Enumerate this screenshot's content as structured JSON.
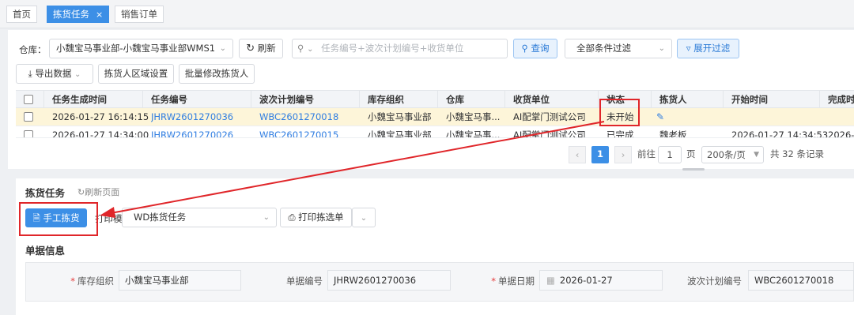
{
  "tabs": [
    {
      "label": "首页"
    },
    {
      "label": "拣货任务",
      "close": "×"
    },
    {
      "label": "销售订单"
    }
  ],
  "toolbar": {
    "warehouse_label": "仓库：",
    "warehouse_value": "小魏宝马事业部-小魏宝马事业部WMS1",
    "refresh_label": "刷新",
    "search_placeholder": "任务编号+波次计划编号+收货单位",
    "query_label": "查询",
    "filter_value": "全部条件过滤",
    "expand_filter_label": "展开过滤",
    "export_label": "导出数据",
    "picker_area_label": "拣货人区域设置",
    "batch_edit_label": "批量修改拣货人"
  },
  "table": {
    "columns": [
      "任务生成时间",
      "任务编号",
      "波次计划编号",
      "库存组织",
      "仓库",
      "收货单位",
      "状态",
      "拣货人",
      "开始时间",
      "完成时"
    ],
    "rows": [
      [
        "2026-01-27 16:14:15",
        "JHRW2601270036",
        "WBC2601270018",
        "小魏宝马事业部",
        "小魏宝马事...",
        "AI配掌门测试公司",
        "未开始",
        "",
        "",
        ""
      ],
      [
        "2026-01-27 14:34:00",
        "JHRW2601270026",
        "WBC2601270015",
        "小魏宝马事业部",
        "小魏宝马事...",
        "AI配掌门测试公司",
        "已完成",
        "魏老板",
        "2026-01-27 14:34:53",
        "2026-0"
      ]
    ]
  },
  "pagination": {
    "prev": "‹",
    "current_page": "1",
    "next": "›",
    "goto_label": "前往",
    "goto_value": "1",
    "page_unit": "页",
    "page_size": "200条/页",
    "total": "共 32 条记录"
  },
  "detail": {
    "title": "拣货任务",
    "refresh_label": "刷新页面",
    "manual_pick_label": "手工拣货",
    "print_template_label": "打印模板",
    "print_template_value": "WD拣货任务",
    "print_pick_list_label": "打印拣选单",
    "section_title": "单据信息",
    "fields": [
      {
        "label": "库存组织",
        "required": true,
        "value": "小魏宝马事业部"
      },
      {
        "label": "单据编号",
        "required": false,
        "value": "JHRW2601270036"
      },
      {
        "label": "单据日期",
        "required": true,
        "value": "2026-01-27"
      },
      {
        "label": "波次计划编号",
        "required": false,
        "value": "WBC2601270018"
      }
    ]
  },
  "colors": {
    "accent": "#3c8fe6",
    "highlight_row": "#fdf5d9",
    "annotation": "#e0262a",
    "link": "#2f7de1"
  }
}
